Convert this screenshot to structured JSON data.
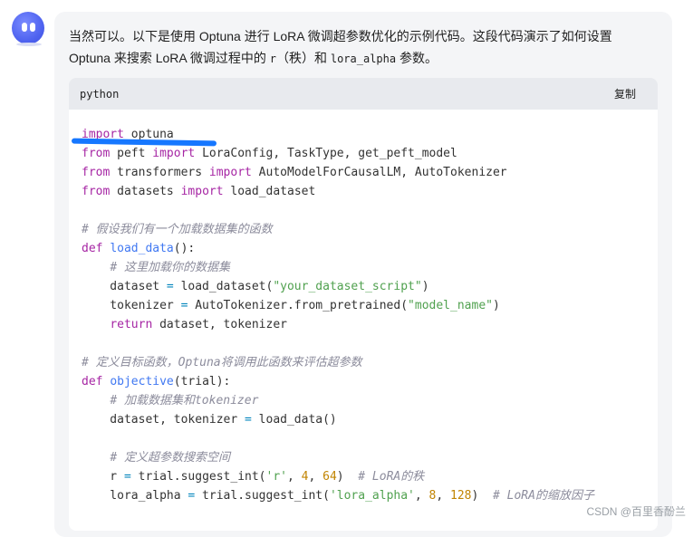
{
  "chat": {
    "message_intro": "当然可以。以下是使用 Optuna 进行 LoRA 微调超参数优化的示例代码。这段代码演示了如何设置",
    "message_line2_a": "Optuna 来搜索 LoRA 微调过程中的 ",
    "message_code_r": "r",
    "message_line2_b": "（秩）和 ",
    "message_code_alpha": "lora_alpha",
    "message_line2_c": " 参数。"
  },
  "code_block": {
    "language": "python",
    "copy_label": "复制",
    "lines": [
      [
        {
          "t": "import",
          "c": "kw"
        },
        {
          "t": " optuna",
          "c": ""
        }
      ],
      [
        {
          "t": "from",
          "c": "kw"
        },
        {
          "t": " peft ",
          "c": ""
        },
        {
          "t": "import",
          "c": "kw"
        },
        {
          "t": " LoraConfig, TaskType, get_peft_model",
          "c": ""
        }
      ],
      [
        {
          "t": "from",
          "c": "kw"
        },
        {
          "t": " transformers ",
          "c": ""
        },
        {
          "t": "import",
          "c": "kw"
        },
        {
          "t": " AutoModelForCausalLM, AutoTokenizer",
          "c": ""
        }
      ],
      [
        {
          "t": "from",
          "c": "kw"
        },
        {
          "t": " datasets ",
          "c": ""
        },
        {
          "t": "import",
          "c": "kw"
        },
        {
          "t": " load_dataset",
          "c": ""
        }
      ],
      [],
      [
        {
          "t": "# 假设我们有一个加载数据集的函数",
          "c": "cm"
        }
      ],
      [
        {
          "t": "def",
          "c": "kw"
        },
        {
          "t": " ",
          "c": ""
        },
        {
          "t": "load_data",
          "c": "fn"
        },
        {
          "t": "():",
          "c": ""
        }
      ],
      [
        {
          "t": "    ",
          "c": ""
        },
        {
          "t": "# 这里加载你的数据集",
          "c": "cm"
        }
      ],
      [
        {
          "t": "    dataset ",
          "c": ""
        },
        {
          "t": "=",
          "c": "op"
        },
        {
          "t": " load_dataset(",
          "c": ""
        },
        {
          "t": "\"your_dataset_script\"",
          "c": "str"
        },
        {
          "t": ")",
          "c": ""
        }
      ],
      [
        {
          "t": "    tokenizer ",
          "c": ""
        },
        {
          "t": "=",
          "c": "op"
        },
        {
          "t": " AutoTokenizer.from_pretrained(",
          "c": ""
        },
        {
          "t": "\"model_name\"",
          "c": "str"
        },
        {
          "t": ")",
          "c": ""
        }
      ],
      [
        {
          "t": "    ",
          "c": ""
        },
        {
          "t": "return",
          "c": "kw"
        },
        {
          "t": " dataset, tokenizer",
          "c": ""
        }
      ],
      [],
      [
        {
          "t": "# 定义目标函数，Optuna将调用此函数来评估超参数",
          "c": "cm"
        }
      ],
      [
        {
          "t": "def",
          "c": "kw"
        },
        {
          "t": " ",
          "c": ""
        },
        {
          "t": "objective",
          "c": "fn"
        },
        {
          "t": "(trial):",
          "c": ""
        }
      ],
      [
        {
          "t": "    ",
          "c": ""
        },
        {
          "t": "# 加载数据集和tokenizer",
          "c": "cm"
        }
      ],
      [
        {
          "t": "    dataset, tokenizer ",
          "c": ""
        },
        {
          "t": "=",
          "c": "op"
        },
        {
          "t": " load_data()",
          "c": ""
        }
      ],
      [],
      [
        {
          "t": "    ",
          "c": ""
        },
        {
          "t": "# 定义超参数搜索空间",
          "c": "cm"
        }
      ],
      [
        {
          "t": "    r ",
          "c": ""
        },
        {
          "t": "=",
          "c": "op"
        },
        {
          "t": " trial.suggest_int(",
          "c": ""
        },
        {
          "t": "'r'",
          "c": "str"
        },
        {
          "t": ", ",
          "c": ""
        },
        {
          "t": "4",
          "c": "num"
        },
        {
          "t": ", ",
          "c": ""
        },
        {
          "t": "64",
          "c": "num"
        },
        {
          "t": ")  ",
          "c": ""
        },
        {
          "t": "# LoRA的秩",
          "c": "cm"
        }
      ],
      [
        {
          "t": "    lora_alpha ",
          "c": ""
        },
        {
          "t": "=",
          "c": "op"
        },
        {
          "t": " trial.suggest_int(",
          "c": ""
        },
        {
          "t": "'lora_alpha'",
          "c": "str"
        },
        {
          "t": ", ",
          "c": ""
        },
        {
          "t": "8",
          "c": "num"
        },
        {
          "t": ", ",
          "c": ""
        },
        {
          "t": "128",
          "c": "num"
        },
        {
          "t": ")  ",
          "c": ""
        },
        {
          "t": "# LoRA的缩放因子",
          "c": "cm"
        }
      ]
    ]
  },
  "watermark": "CSDN @百里香酚兰",
  "colors": {
    "avatar": "#4f63f0",
    "bubble_bg": "#f4f5f7",
    "code_header_bg": "#e8eaee",
    "keyword": "#a626a4",
    "function": "#4078f2",
    "string": "#50a14f",
    "number": "#c18401",
    "comment": "#8c8c9c",
    "annotation_underline": "#1677ff"
  }
}
